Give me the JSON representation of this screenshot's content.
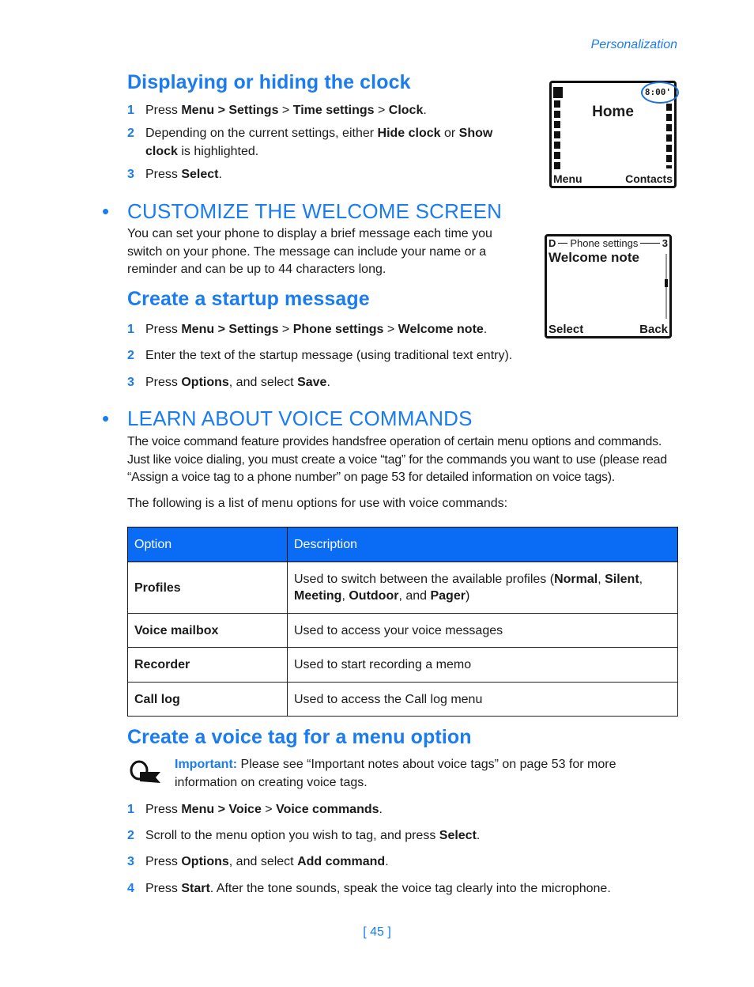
{
  "header": {
    "section": "Personalization"
  },
  "clock_section": {
    "title": "Displaying or hiding the clock",
    "steps": [
      {
        "num": "1",
        "parts": [
          [
            "Press ",
            false
          ],
          [
            "Menu > Settings",
            true
          ],
          [
            " > ",
            false
          ],
          [
            "Time settings",
            true
          ],
          [
            " > ",
            false
          ],
          [
            "Clock",
            true
          ],
          [
            ".",
            false
          ]
        ]
      },
      {
        "num": "2",
        "parts": [
          [
            "Depending on the current settings, either ",
            false
          ],
          [
            "Hide clock",
            true
          ],
          [
            " or ",
            false
          ],
          [
            "Show clock",
            true
          ],
          [
            " is highlighted.",
            false
          ]
        ]
      },
      {
        "num": "3",
        "parts": [
          [
            "Press ",
            false
          ],
          [
            "Select",
            true
          ],
          [
            ".",
            false
          ]
        ]
      }
    ],
    "screen": {
      "time": "8:00'",
      "title": "Home",
      "left_soft": "Menu",
      "right_soft": "Contacts"
    }
  },
  "welcome_section": {
    "bullet": "•",
    "title": "CUSTOMIZE THE WELCOME SCREEN",
    "intro": "You can set your phone to display a brief message each time you switch on your phone. The message can include your name or a reminder and can be up to 44 characters long.",
    "subtitle": "Create a startup message",
    "steps": [
      {
        "num": "1",
        "parts": [
          [
            "Press ",
            false
          ],
          [
            "Menu > Settings",
            true
          ],
          [
            " > ",
            false
          ],
          [
            "Phone settings",
            true
          ],
          [
            " > ",
            false
          ],
          [
            "Welcome note",
            true
          ],
          [
            ".",
            false
          ]
        ]
      },
      {
        "num": "2",
        "parts": [
          [
            "Enter the text of the startup message (using traditional text entry).",
            false
          ]
        ]
      },
      {
        "num": "3",
        "parts": [
          [
            "Press ",
            false
          ],
          [
            "Options",
            true
          ],
          [
            ", and select ",
            false
          ],
          [
            "Save",
            true
          ],
          [
            ".",
            false
          ]
        ]
      }
    ],
    "screen": {
      "left_num": "D",
      "menu": "Phone settings",
      "right_num": "3",
      "item": "Welcome note",
      "left_soft": "Select",
      "right_soft": "Back"
    }
  },
  "voice_section": {
    "bullet": "•",
    "title": "LEARN ABOUT VOICE COMMANDS",
    "intro": "The voice command feature provides handsfree operation of certain menu options and commands. Just like voice dialing, you must create a voice “tag” for the commands you want to use (please read “Assign a voice tag to a phone number” on page 53 for detailed information on voice tags).",
    "list_intro": "The following is a list of menu options for use with voice commands:",
    "table": {
      "headers": [
        "Option",
        "Description"
      ],
      "rows": [
        {
          "option": "Profiles",
          "parts": [
            [
              "Used to switch between the available profiles (",
              false
            ],
            [
              "Normal",
              true
            ],
            [
              ", ",
              false
            ],
            [
              "Silent",
              true
            ],
            [
              ", ",
              false
            ],
            [
              "Meeting",
              true
            ],
            [
              ", ",
              false
            ],
            [
              "Outdoor",
              true
            ],
            [
              ", and ",
              false
            ],
            [
              "Pager",
              true
            ],
            [
              ")",
              false
            ]
          ]
        },
        {
          "option": "Voice mailbox",
          "parts": [
            [
              "Used to access your voice messages",
              false
            ]
          ]
        },
        {
          "option": "Recorder",
          "parts": [
            [
              "Used to start recording a memo",
              false
            ]
          ]
        },
        {
          "option": "Call log",
          "parts": [
            [
              "Used to access the Call log menu",
              false
            ]
          ]
        }
      ]
    },
    "subtitle": "Create a voice tag for a menu option",
    "note_label": "Important:",
    "note_text": " Please see “Important notes about voice tags” on page 53 for more information on creating voice tags.",
    "steps": [
      {
        "num": "1",
        "parts": [
          [
            "Press ",
            false
          ],
          [
            "Menu > Voice",
            true
          ],
          [
            " > ",
            false
          ],
          [
            "Voice commands",
            true
          ],
          [
            ".",
            false
          ]
        ]
      },
      {
        "num": "2",
        "parts": [
          [
            "Scroll to the menu option you wish to tag, and press ",
            false
          ],
          [
            "Select",
            true
          ],
          [
            ".",
            false
          ]
        ]
      },
      {
        "num": "3",
        "parts": [
          [
            "Press ",
            false
          ],
          [
            "Options",
            true
          ],
          [
            ", and select ",
            false
          ],
          [
            "Add command",
            true
          ],
          [
            ".",
            false
          ]
        ]
      },
      {
        "num": "4",
        "parts": [
          [
            "Press ",
            false
          ],
          [
            "Start",
            true
          ],
          [
            ". After the tone sounds, speak the voice tag clearly into the microphone.",
            false
          ]
        ]
      }
    ]
  },
  "footer": {
    "page": "[ 45 ]"
  }
}
